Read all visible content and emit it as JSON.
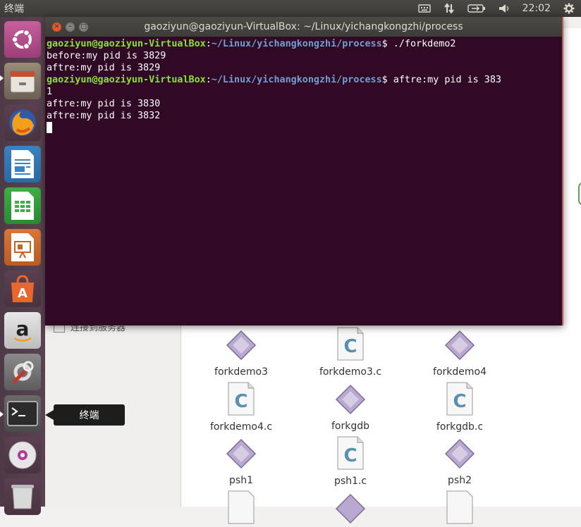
{
  "top_panel": {
    "title": "终端",
    "clock": "22:02"
  },
  "launcher": {
    "items": [
      {
        "name": "Ubuntu Dash",
        "icon": "ubuntu-logo-icon"
      },
      {
        "name": "Files",
        "icon": "files-icon"
      },
      {
        "name": "Firefox",
        "icon": "firefox-icon"
      },
      {
        "name": "LibreOffice Writer",
        "icon": "writer-icon"
      },
      {
        "name": "LibreOffice Calc",
        "icon": "calc-icon"
      },
      {
        "name": "LibreOffice Impress",
        "icon": "impress-icon"
      },
      {
        "name": "Ubuntu Software",
        "icon": "software-center-icon"
      },
      {
        "name": "Amazon",
        "icon": "amazon-icon"
      },
      {
        "name": "System Settings",
        "icon": "settings-icon"
      },
      {
        "name": "Terminal",
        "icon": "terminal-icon"
      },
      {
        "name": "DVD",
        "icon": "disc-icon"
      },
      {
        "name": "Trash",
        "icon": "trash-icon"
      }
    ],
    "tooltip": "终端"
  },
  "terminal": {
    "title": "gaoziyun@gaoziyun-VirtualBox: ~/Linux/yichangkongzhi/process",
    "lines": [
      {
        "user": "gaoziyun@gaoziyun-VirtualBox",
        "sep": ":",
        "path": "~/Linux/yichangkongzhi/process",
        "cmd": "$ ./forkdemo2"
      },
      {
        "text": "before:my pid is 3829"
      },
      {
        "text": "aftre:my pid is 3829"
      },
      {
        "user": "gaoziyun@gaoziyun-VirtualBox",
        "sep": ":",
        "path": "~/Linux/yichangkongzhi/process",
        "cmd": "$ aftre:my pid is 383"
      },
      {
        "text": "1"
      },
      {
        "text": "aftre:my pid is 3830"
      },
      {
        "text": "aftre:my pid is 3832"
      }
    ]
  },
  "file_manager": {
    "sidebar_item": "连接到服务器",
    "files": [
      {
        "name": "forkdemo3",
        "type": "exec"
      },
      {
        "name": "forkdemo3.c",
        "type": "c"
      },
      {
        "name": "forkdemo4",
        "type": "exec"
      },
      {
        "name": "forkdemo4.c",
        "type": "c"
      },
      {
        "name": "forkgdb",
        "type": "exec"
      },
      {
        "name": "forkgdb.c",
        "type": "c"
      },
      {
        "name": "psh1",
        "type": "exec"
      },
      {
        "name": "psh1.c",
        "type": "c"
      },
      {
        "name": "psh2",
        "type": "exec"
      }
    ]
  },
  "colors": {
    "terminal_bg": "#300a24",
    "prompt_user": "#8ae234",
    "prompt_path": "#729fcf"
  }
}
